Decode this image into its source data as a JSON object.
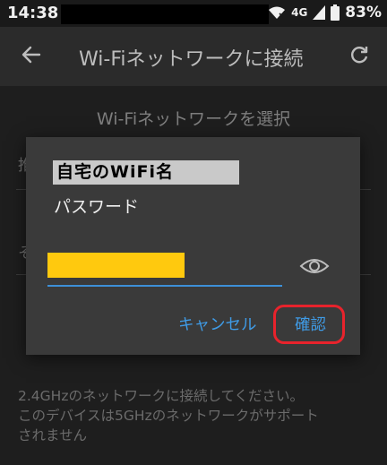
{
  "status_bar": {
    "time": "14:38",
    "network": "4G",
    "battery": "83%",
    "icons": [
      "wifi-icon",
      "signal-icon",
      "battery-icon"
    ]
  },
  "app_bar": {
    "title": "Wi-Fiネットワークに接続",
    "back_icon": "arrow-left-icon",
    "refresh_icon": "refresh-icon"
  },
  "page": {
    "subtitle": "Wi-Fiネットワークを選択",
    "footer_note_line1": "2.4GHzのネットワークに接続してください。",
    "footer_note_line2": "このデバイスは5GHzのネットワークがサポート",
    "footer_note_line3": "されません",
    "background_items": [
      "推",
      "そ"
    ]
  },
  "dialog": {
    "ssid": "自宅のWiFi名",
    "password_label": "パスワード",
    "password_value": "",
    "show_password_icon": "eye-icon",
    "cancel_label": "キャンセル",
    "confirm_label": "確認"
  },
  "colors": {
    "accent": "#3f9be6",
    "highlight_fill": "#ffc90e",
    "annotation_red": "#e8232c",
    "dialog_bg": "#3a3a3a",
    "app_bar_bg": "#2b2b2b"
  }
}
